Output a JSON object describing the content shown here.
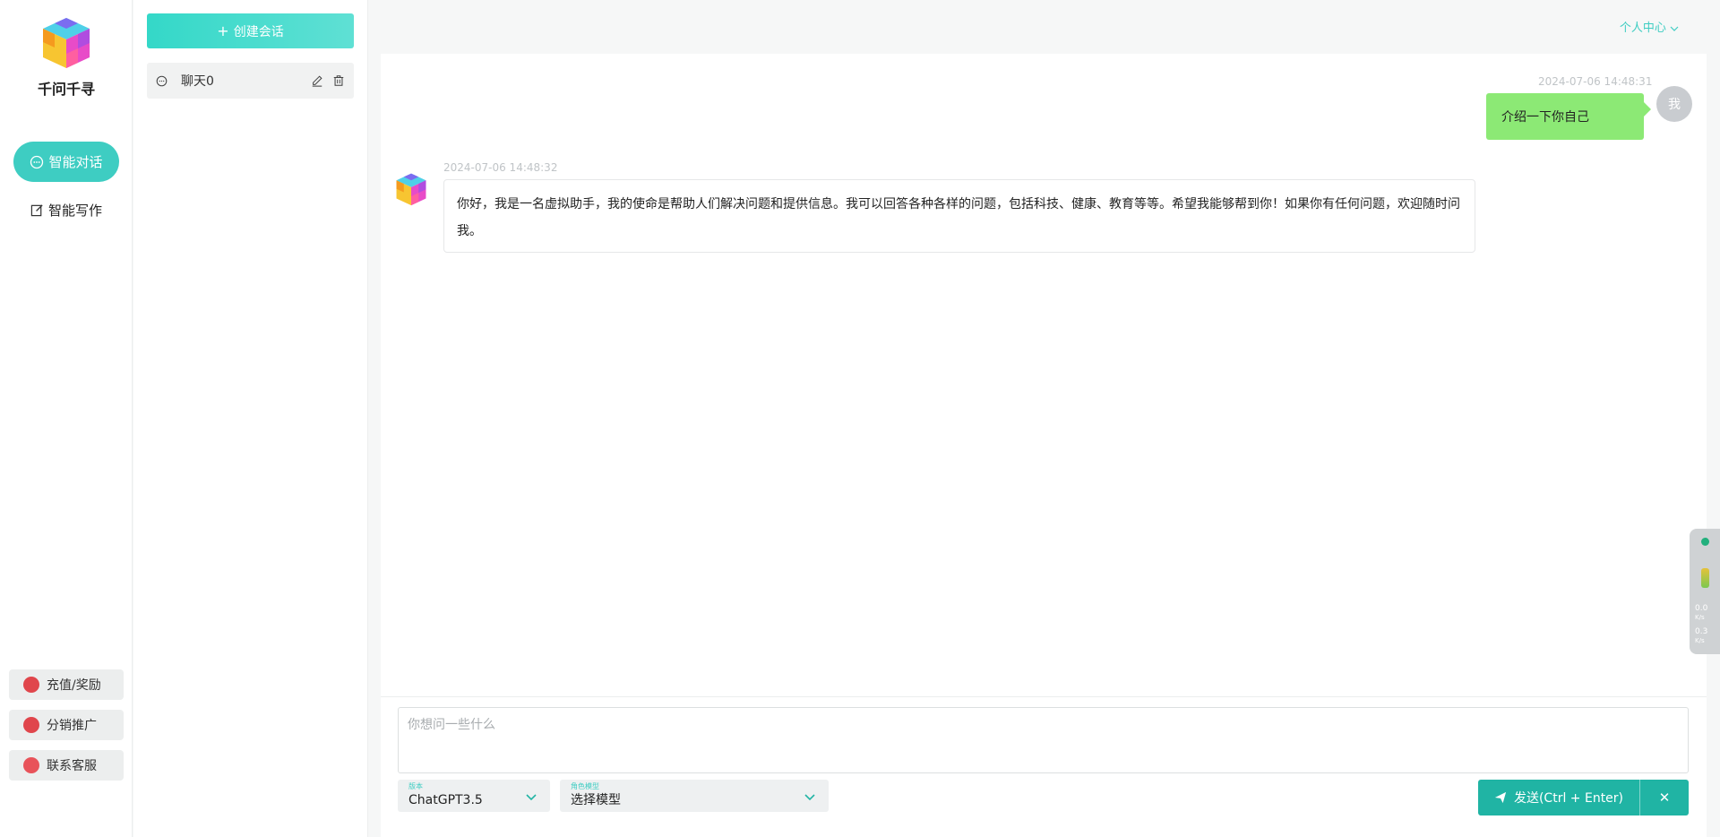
{
  "nav": {
    "brand": "千问千寻",
    "items": [
      {
        "label": "智能对话",
        "active": true
      },
      {
        "label": "智能写作",
        "active": false
      }
    ],
    "bottom_buttons": [
      {
        "label": "充值/奖励"
      },
      {
        "label": "分销推广"
      },
      {
        "label": "联系客服"
      }
    ]
  },
  "sessions": {
    "create_label": "创建会话",
    "items": [
      {
        "label": "聊天0"
      }
    ]
  },
  "header": {
    "user_center": "个人中心"
  },
  "chat": {
    "messages": [
      {
        "role": "user",
        "time": "2024-07-06 14:48:31",
        "avatar_text": "我",
        "text": "介绍一下你自己"
      },
      {
        "role": "assistant",
        "time": "2024-07-06 14:48:32",
        "text": "你好，我是一名虚拟助手，我的使命是帮助人们解决问题和提供信息。我可以回答各种各样的问题，包括科技、健康、教育等等。希望我能够帮到你！如果你有任何问题，欢迎随时问我。"
      }
    ],
    "input": {
      "placeholder": "你想问一些什么",
      "value": ""
    },
    "version_select": {
      "caption": "版本",
      "value": "ChatGPT3.5"
    },
    "role_select": {
      "caption": "角色模型",
      "value": "选择模型"
    },
    "send_label": "发送(Ctrl + Enter)",
    "close_label": "✕"
  },
  "widget": {
    "up_speed": "0.0",
    "down_speed": "0.3",
    "unit": "K/s"
  },
  "colors": {
    "accent": "#3ecdc2",
    "send": "#20b4a4",
    "user_bubble": "#8ce975"
  }
}
